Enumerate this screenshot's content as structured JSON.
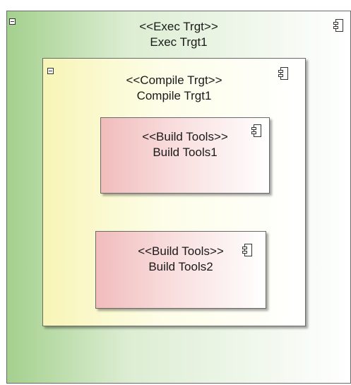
{
  "diagram": {
    "exec_target": {
      "stereotype": "<<Exec Trgt>>",
      "name": "Exec Trgt1",
      "color": "#a4d08e"
    },
    "compile_target": {
      "stereotype": "<<Compile Trgt>>",
      "name": "Compile Trgt1",
      "color": "#f7f5b6"
    },
    "build_tools": [
      {
        "stereotype": "<<Build Tools>>",
        "name": "Build Tools1",
        "color": "#f1bcbc"
      },
      {
        "stereotype": "<<Build Tools>>",
        "name": "Build Tools2",
        "color": "#f1bcbc"
      }
    ],
    "icons": {
      "collapse": "collapse-icon",
      "component": "component-icon"
    }
  }
}
